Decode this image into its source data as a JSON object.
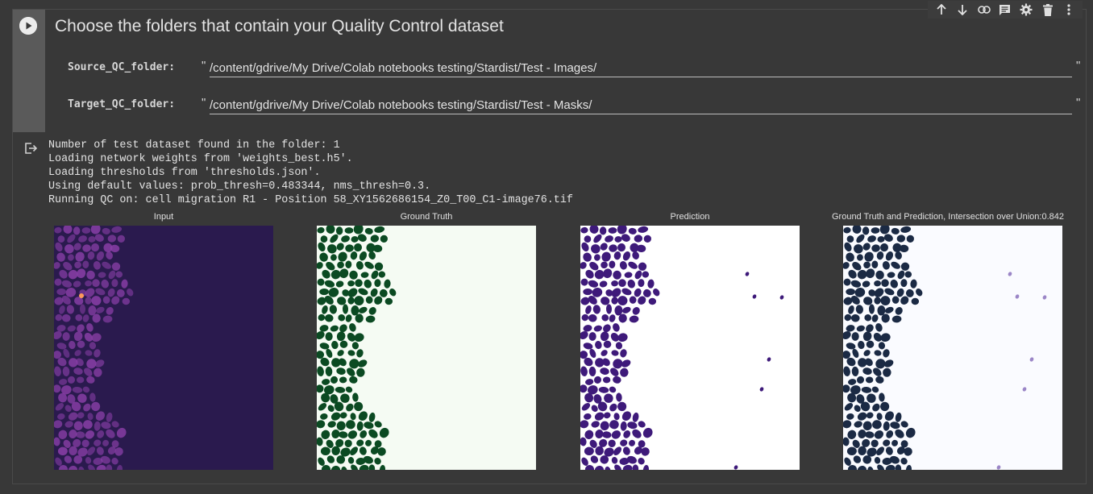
{
  "toolbar": {
    "icons": [
      "arrow-up-icon",
      "arrow-down-icon",
      "link-icon",
      "comment-icon",
      "gear-icon",
      "trash-icon",
      "more-vert-icon"
    ]
  },
  "cell": {
    "title": "Choose the folders that contain your Quality Control dataset",
    "fields": [
      {
        "label": "Source_QC_folder:",
        "value": "/content/gdrive/My Drive/Colab notebooks testing/Stardist/Test - Images/"
      },
      {
        "label": "Target_QC_folder:",
        "value": "/content/gdrive/My Drive/Colab notebooks testing/Stardist/Test - Masks/"
      }
    ],
    "quote_char": "\""
  },
  "output": {
    "lines": [
      "Number of test dataset found in the folder: 1",
      "Loading network weights from 'weights_best.h5'.",
      "Loading thresholds from 'thresholds.json'.",
      "Using default values: prob_thresh=0.483344, nms_thresh=0.3.",
      "Running QC on: cell migration R1 - Position 58_XY1562686154_Z0_T00_C1-image76.tif"
    ],
    "panels": [
      {
        "title": "Input"
      },
      {
        "title": "Ground Truth"
      },
      {
        "title": "Prediction"
      },
      {
        "title": "Ground Truth and Prediction, Intersection over Union:0.842"
      }
    ]
  },
  "colors": {
    "input_bg": "#2a1a4e",
    "input_cells": "#8a3fa8",
    "gt_cells": "#0b4a22",
    "gt_bg": "#f5fbf3",
    "pred_cells": "#3e1a7a",
    "overlay_cells": "#1b2a44",
    "overlay_pred_only": "#9b86c7"
  }
}
